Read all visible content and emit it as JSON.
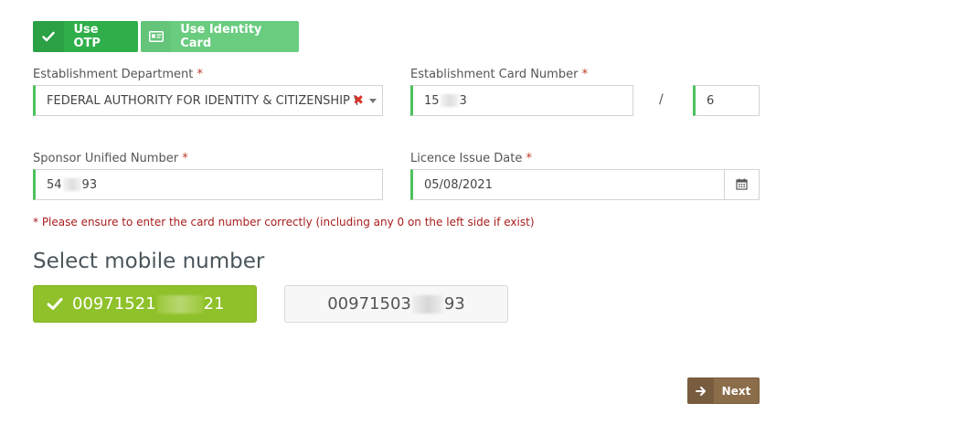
{
  "auth_toggle": {
    "otp_label": "Use OTP",
    "identity_label": "Use Identity Card"
  },
  "form": {
    "establishment_department": {
      "label": "Establishment Department",
      "required_mark": "*",
      "value": "FEDERAL AUTHORITY FOR IDENTITY & CITIZENSHIP \\"
    },
    "establishment_card_number": {
      "label": "Establishment Card Number",
      "required_mark": "*",
      "value_prefix": "15",
      "value_suffix": "3",
      "separator": "/",
      "secondary_value": "6"
    },
    "sponsor_unified_number": {
      "label": "Sponsor Unified Number",
      "required_mark": "*",
      "value_prefix": "54",
      "value_suffix": "93"
    },
    "licence_issue_date": {
      "label": "Licence Issue Date",
      "required_mark": "*",
      "value": "05/08/2021"
    },
    "warning": "* Please ensure to enter the card number correctly (including any 0 on the left side if exist)"
  },
  "mobile": {
    "title": "Select mobile number",
    "options": [
      {
        "prefix": "00971521",
        "suffix": "21",
        "selected": true
      },
      {
        "prefix": "00971503",
        "suffix": "93",
        "selected": false
      }
    ]
  },
  "actions": {
    "next_label": "Next"
  },
  "colors": {
    "otp_green": "#2fae4a",
    "identity_green": "#69cc7f",
    "field_accent": "#4cc15e",
    "selected_mobile": "#8fc12a",
    "warning_red": "#a81d1d",
    "next_brown": "#8c6d4a"
  }
}
